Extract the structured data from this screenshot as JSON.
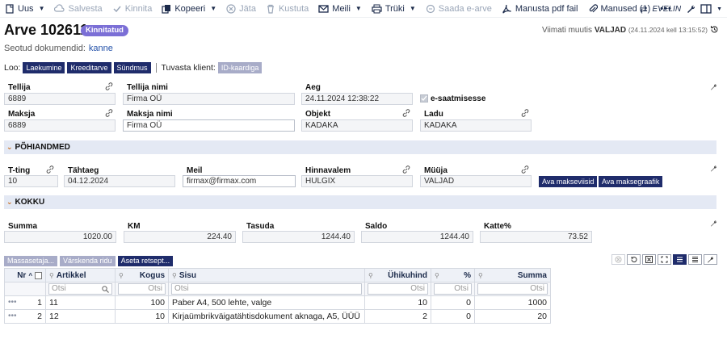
{
  "toolbar": {
    "items": [
      {
        "label": "Uus",
        "icon": "new-document-icon",
        "disabled": false,
        "caret": true
      },
      {
        "label": "Salvesta",
        "icon": "save-cloud-icon",
        "disabled": true,
        "caret": false
      },
      {
        "label": "Kinnita",
        "icon": "check-icon",
        "disabled": true,
        "caret": false
      },
      {
        "label": "Kopeeri",
        "icon": "copy-icon",
        "disabled": false,
        "caret": true
      },
      {
        "label": "Jäta",
        "icon": "cancel-circle-icon",
        "disabled": true,
        "caret": false
      },
      {
        "label": "Kustuta",
        "icon": "trash-icon",
        "disabled": true,
        "caret": false
      },
      {
        "label": "Meili",
        "icon": "mail-icon",
        "disabled": false,
        "caret": true
      },
      {
        "label": "Trüki",
        "icon": "printer-icon",
        "disabled": false,
        "caret": true
      },
      {
        "label": "Saada e-arve",
        "icon": "e-invoice-icon",
        "disabled": true,
        "caret": false
      },
      {
        "label": "Manusta pdf fail",
        "icon": "pdf-icon",
        "disabled": false,
        "caret": false
      },
      {
        "label": "Manused (1)",
        "icon": "paperclip-icon",
        "disabled": false,
        "caret": false
      }
    ],
    "more": "•••",
    "user": "EVELIN"
  },
  "header": {
    "title": "Arve 102611",
    "badge": "Kinnitatud",
    "last_modified_label": "Viimati muutis",
    "last_modified_user": "VALJAD",
    "last_modified_time": "(24.11.2024 kell 13:15:52)",
    "linked_label": "Seotud dokumendid:",
    "linked_link": "kanne"
  },
  "loo": {
    "label": "Loo:",
    "buttons": [
      "Laekumine",
      "Kreeditarve",
      "Sündmus"
    ],
    "client_label": "Tuvasta klient:",
    "client_button": "ID-kaardiga"
  },
  "fields": {
    "tellija": {
      "label": "Tellija",
      "value": "6889"
    },
    "tellija_nimi": {
      "label": "Tellija nimi",
      "value": "Firma OÜ"
    },
    "aeg": {
      "label": "Aeg",
      "value": "24.11.2024 12:38:22"
    },
    "esaatmine": {
      "label": "e-saatmisesse",
      "checked": true
    },
    "maksja": {
      "label": "Maksja",
      "value": "6889"
    },
    "maksja_nimi": {
      "label": "Maksja nimi",
      "value": "Firma OÜ"
    },
    "objekt": {
      "label": "Objekt",
      "value": "KADAKA"
    },
    "ladu": {
      "label": "Ladu",
      "value": "KADAKA"
    }
  },
  "sections": {
    "pohiandmed": "PÕHIANDMED",
    "kokku": "KOKKU"
  },
  "pohiandmed": {
    "tting": {
      "label": "T-ting",
      "value": "10"
    },
    "tahtaeg": {
      "label": "Tähtaeg",
      "value": "04.12.2024"
    },
    "meil": {
      "label": "Meil",
      "value": "firmax@firmax.com"
    },
    "hinnavalem": {
      "label": "Hinnavalem",
      "value": "HULGIX"
    },
    "muuja": {
      "label": "Müüja",
      "value": "VALJAD"
    },
    "btn_makseviisid": "Ava makseviisid",
    "btn_maksegraafik": "Ava maksegraafik"
  },
  "kokku": {
    "summa": {
      "label": "Summa",
      "value": "1020.00"
    },
    "km": {
      "label": "KM",
      "value": "224.40"
    },
    "tasuda": {
      "label": "Tasuda",
      "value": "1244.40"
    },
    "saldo": {
      "label": "Saldo",
      "value": "1244.40"
    },
    "katte": {
      "label": "Katte%",
      "value": "73.52"
    }
  },
  "grid": {
    "buttons": [
      "Massasetaja...",
      "Värskenda ridu",
      "Aseta retsept..."
    ],
    "columns": {
      "nr": "Nr",
      "artikkel": "Artikkel",
      "kogus": "Kogus",
      "sisu": "Sisu",
      "uhikuhind": "Ühikuhind",
      "protsent": "%",
      "summa": "Summa"
    },
    "filter_placeholder": "Otsi",
    "rows": [
      {
        "nr": "1",
        "artikkel": "11",
        "kogus": "100",
        "sisu": "Paber A4, 500 lehte, valge",
        "uhikuhind": "10",
        "protsent": "0",
        "summa": "1000"
      },
      {
        "nr": "2",
        "artikkel": "12",
        "kogus": "10",
        "sisu": "Kirjaümbrikväigatähtisdokument aknaga, A5, ÜÜÜ",
        "uhikuhind": "2",
        "protsent": "0",
        "summa": "20"
      }
    ]
  }
}
